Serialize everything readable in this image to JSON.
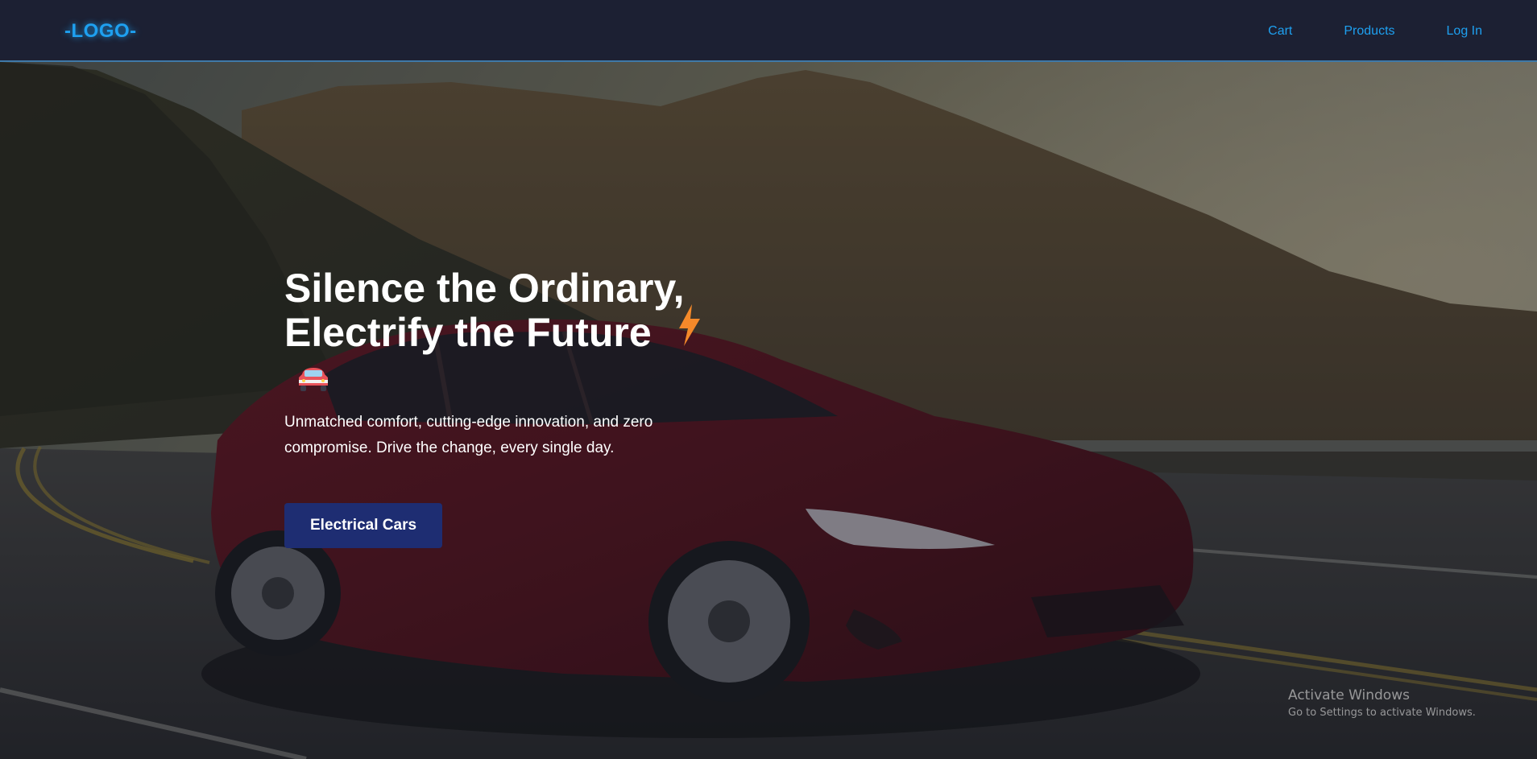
{
  "nav": {
    "logo": "-LOGO-",
    "links": [
      "Cart",
      "Products",
      "Log In"
    ]
  },
  "hero": {
    "title_line1": "Silence the Ordinary,",
    "title_line2": "Electrify the Future",
    "bolt_icon": "lightning-bolt-icon",
    "car_icon": "car-emoji-icon",
    "description": "Unmatched comfort, cutting-edge innovation, and zero compromise. Drive the change, every single day.",
    "cta_label": "Electrical Cars"
  },
  "watermark": {
    "title": "Activate Windows",
    "subtitle": "Go to Settings to activate Windows."
  },
  "colors": {
    "accent": "#1ea0f0",
    "nav_bg": "#1c2033",
    "cta_bg": "#1e2d72",
    "bolt": "#f5892a"
  }
}
